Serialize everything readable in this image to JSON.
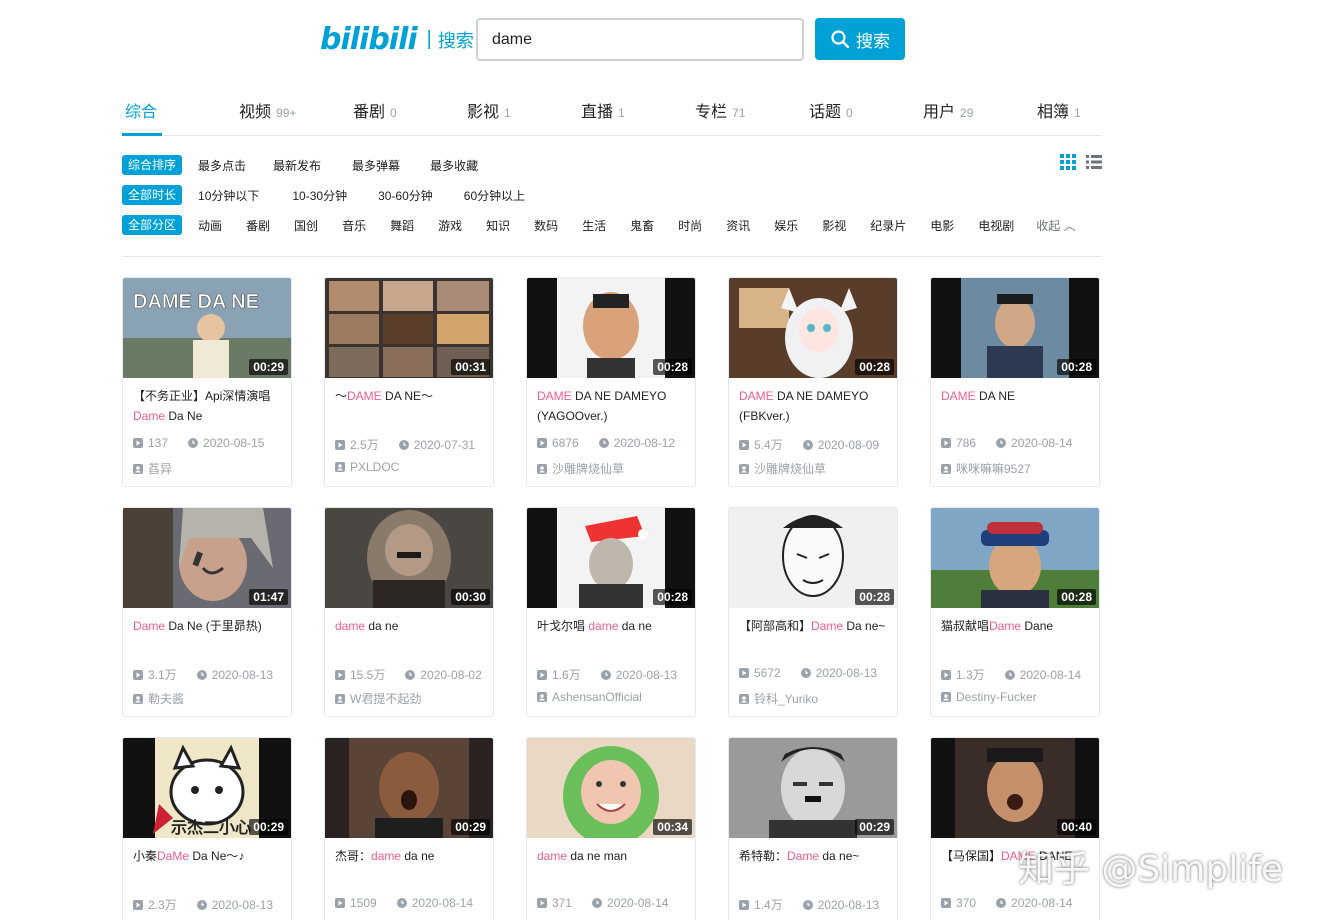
{
  "header": {
    "logo": "bilibili",
    "logo_section": "搜索",
    "search_value": "dame",
    "search_button": "搜索"
  },
  "tabs": [
    {
      "label": "综合",
      "count": ""
    },
    {
      "label": "视频",
      "count": "99+"
    },
    {
      "label": "番剧",
      "count": "0"
    },
    {
      "label": "影视",
      "count": "1"
    },
    {
      "label": "直播",
      "count": "1"
    },
    {
      "label": "专栏",
      "count": "71"
    },
    {
      "label": "话题",
      "count": "0"
    },
    {
      "label": "用户",
      "count": "29"
    },
    {
      "label": "相簿",
      "count": "1"
    }
  ],
  "filters": {
    "order": {
      "active": "综合排序",
      "items": [
        "最多点击",
        "最新发布",
        "最多弹幕",
        "最多收藏"
      ]
    },
    "duration": {
      "active": "全部时长",
      "items": [
        "10分钟以下",
        "10-30分钟",
        "30-60分钟",
        "60分钟以上"
      ]
    },
    "zone": {
      "active": "全部分区",
      "items": [
        "动画",
        "番剧",
        "国创",
        "音乐",
        "舞蹈",
        "游戏",
        "知识",
        "数码",
        "生活",
        "鬼畜",
        "时尚",
        "资讯",
        "娱乐",
        "影视",
        "纪录片",
        "电影",
        "电视剧"
      ],
      "collapse": "收起"
    }
  },
  "videos": [
    {
      "duration": "00:29",
      "title_pre": "【不务正业】Api深情演唱",
      "title_hl": "Dame",
      "title_post": " Da Ne",
      "plays": "137",
      "date": "2020-08-15",
      "up": "萏异"
    },
    {
      "duration": "00:31",
      "title_pre": "～",
      "title_hl": "DAME",
      "title_post": " DA NE～",
      "plays": "2.5万",
      "date": "2020-07-31",
      "up": "PXLDOC"
    },
    {
      "duration": "00:28",
      "title_pre": "",
      "title_hl": "DAME",
      "title_post": " DA NE DAMEYO (YAGOOver.)",
      "plays": "6876",
      "date": "2020-08-12",
      "up": "沙雕牌烧仙草"
    },
    {
      "duration": "00:28",
      "title_pre": "",
      "title_hl": "DAME",
      "title_post": " DA NE DAMEYO (FBKver.)",
      "plays": "5.4万",
      "date": "2020-08-09",
      "up": "沙雕牌烧仙草"
    },
    {
      "duration": "00:28",
      "title_pre": "",
      "title_hl": "DAME",
      "title_post": " DA NE",
      "plays": "786",
      "date": "2020-08-14",
      "up": "咪咪嘛嘛9527"
    },
    {
      "duration": "01:47",
      "title_pre": "",
      "title_hl": "Dame",
      "title_post": " Da Ne (于里昴热)",
      "plays": "3.1万",
      "date": "2020-08-13",
      "up": "勒夫酱"
    },
    {
      "duration": "00:30",
      "title_pre": "",
      "title_hl": "dame",
      "title_post": " da ne",
      "plays": "15.5万",
      "date": "2020-08-02",
      "up": "W君提不起劲"
    },
    {
      "duration": "00:28",
      "title_pre": "叶戈尔唱 ",
      "title_hl": "dame",
      "title_post": " da ne",
      "plays": "1.6万",
      "date": "2020-08-13",
      "up": "AshensanOfficial"
    },
    {
      "duration": "00:28",
      "title_pre": "【阿部高和】",
      "title_hl": "Dame",
      "title_post": " Da ne~",
      "plays": "5672",
      "date": "2020-08-13",
      "up": "铃科_Yuriko"
    },
    {
      "duration": "00:28",
      "title_pre": "猫叔献唱",
      "title_hl": "Dame",
      "title_post": " Dane",
      "plays": "1.3万",
      "date": "2020-08-14",
      "up": "Destiny-Fucker"
    },
    {
      "duration": "00:29",
      "title_pre": "小秦",
      "title_hl": "DaMe",
      "title_post": " Da Ne～♪",
      "plays": "2.3万",
      "date": "2020-08-13",
      "up": ""
    },
    {
      "duration": "00:29",
      "title_pre": "杰哥：",
      "title_hl": "dame",
      "title_post": " da ne",
      "plays": "1509",
      "date": "2020-08-14",
      "up": ""
    },
    {
      "duration": "00:34",
      "title_pre": "",
      "title_hl": "dame",
      "title_post": " da ne man",
      "plays": "371",
      "date": "2020-08-14",
      "up": ""
    },
    {
      "duration": "00:29",
      "title_pre": "希特勒：",
      "title_hl": "Dame",
      "title_post": " da ne~",
      "plays": "1.4万",
      "date": "2020-08-13",
      "up": ""
    },
    {
      "duration": "00:40",
      "title_pre": "【马保国】",
      "title_hl": "DAME",
      "title_post": " DANE",
      "plays": "370",
      "date": "2020-08-14",
      "up": ""
    }
  ],
  "watermark": "知乎 @Simplife",
  "colors": {
    "accent": "#00a1d6",
    "highlight": "#f25d8e",
    "muted": "#99a2aa"
  }
}
